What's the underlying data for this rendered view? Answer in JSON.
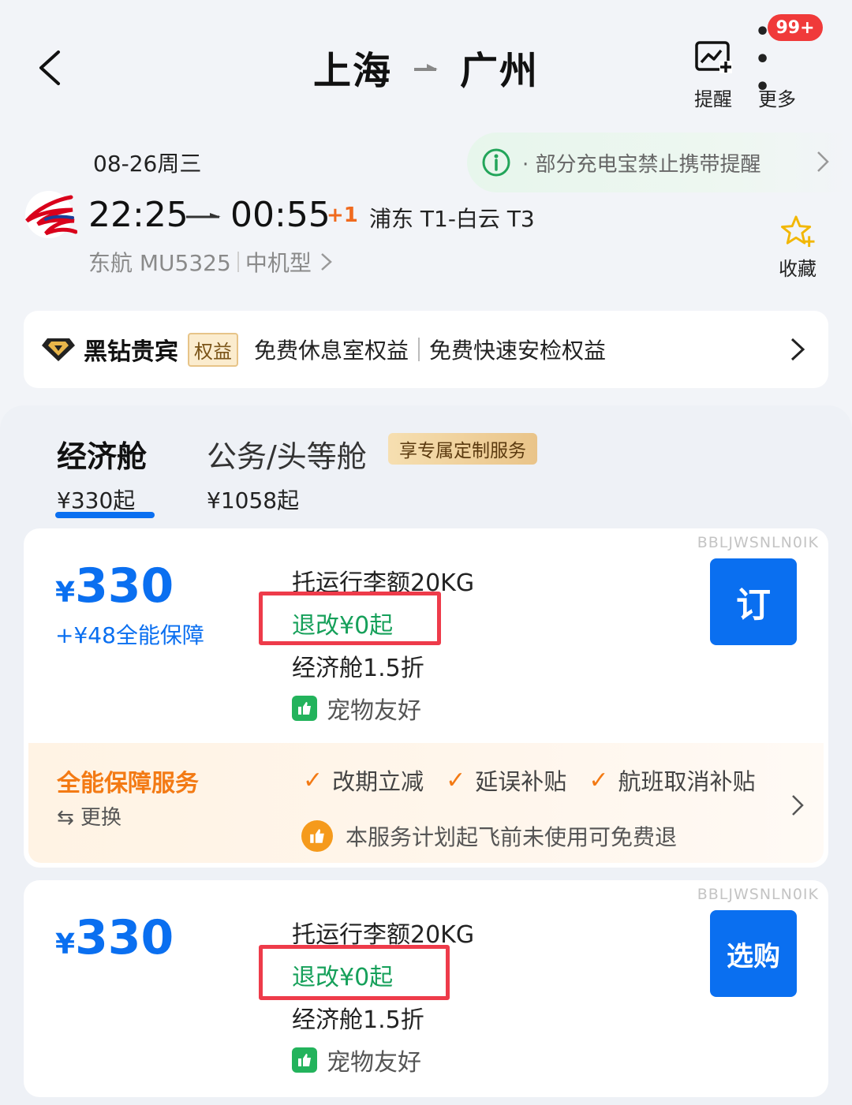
{
  "header": {
    "origin": "上海",
    "destination": "广州",
    "badge": "99+",
    "remind_label": "提醒",
    "more_label": "更多"
  },
  "flight": {
    "date": "08-26周三",
    "notice": "· 部分充电宝禁止携带提醒",
    "dep_time": "22:25",
    "arr_time": "00:55",
    "day_offset": "+1",
    "airports": "浦东 T1-白云 T3",
    "flight_no": "东航 MU5325",
    "aircraft": "中机型",
    "fav_label": "收藏"
  },
  "member": {
    "name": "黑钻贵宾",
    "tag": "权益",
    "benefit_1": "免费休息室权益",
    "benefit_2": "免费快速安检权益"
  },
  "tabs": [
    {
      "name": "经济舱",
      "price": "¥330起",
      "active": true
    },
    {
      "name": "公务/头等舱",
      "price": "¥1058起",
      "active": false
    }
  ],
  "service_pill": "享专属定制服务",
  "fares": [
    {
      "code": "BBLJWSNLN0IK",
      "currency": "¥",
      "price": "330",
      "addon": "+¥48全能保障",
      "baggage": "托运行李额20KG",
      "refund": "退改¥0起",
      "discount": "经济舱1.5折",
      "pet": "宠物友好",
      "button": "订",
      "guarantee": {
        "title": "全能保障服务",
        "swap": "⇆ 更换",
        "items": [
          "改期立减",
          "延误补贴",
          "航班取消补贴"
        ],
        "note": "本服务计划起飞前未使用可免费退"
      }
    },
    {
      "code": "BBLJWSNLN0IK",
      "currency": "¥",
      "price": "330",
      "baggage": "托运行李额20KG",
      "refund": "退改¥0起",
      "discount": "经济舱1.5折",
      "pet": "宠物友好",
      "button": "选购"
    }
  ],
  "colors": {
    "accent": "#0a6ff0",
    "orange": "#f37a14",
    "green": "#16a05a",
    "highlight_box": "#ee3b4a",
    "badge": "#f03a3a"
  }
}
